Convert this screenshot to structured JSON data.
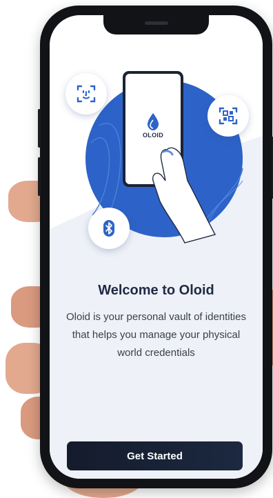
{
  "app": {
    "logo_text": "OLOID"
  },
  "onboarding": {
    "title": "Welcome to Oloid",
    "description": "Oloid is your personal vault of identities that helps you manage your physical world credentials",
    "cta_label": "Get Started"
  },
  "icons": {
    "face_scan": "face-scan-icon",
    "qr_scan": "qr-scan-icon",
    "bluetooth": "bluetooth-icon",
    "logo_drop": "water-drop-icon"
  },
  "colors": {
    "brand_blue": "#2d63c8",
    "light_blue": "#5b8ee6",
    "dark_navy": "#1c2940",
    "title_text": "#1f2a44",
    "screen_bg": "#eef1f7"
  }
}
